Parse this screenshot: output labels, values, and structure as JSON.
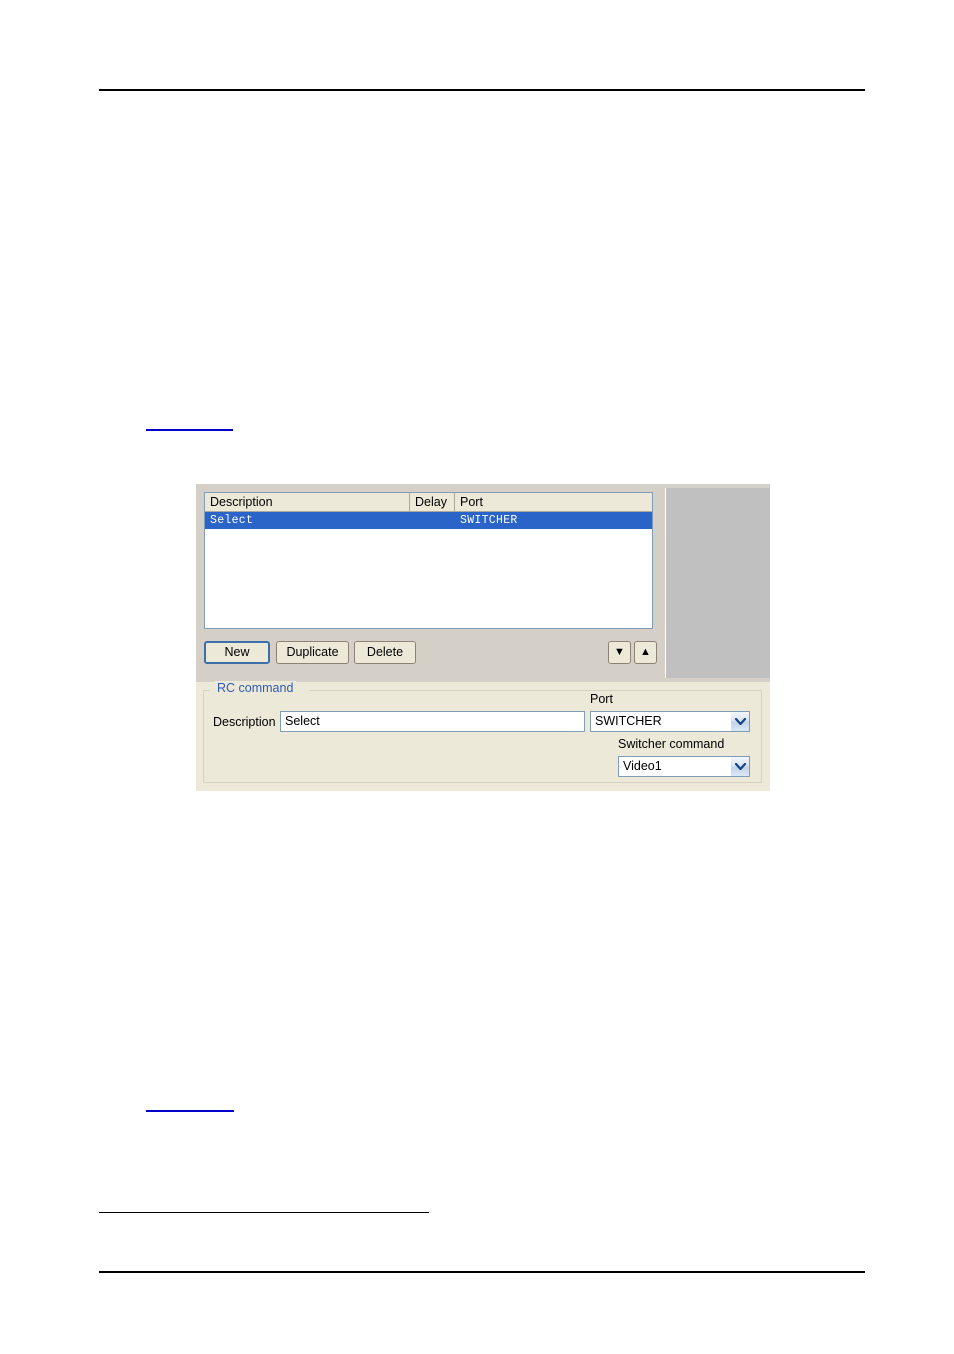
{
  "page": {
    "header_rule": true,
    "footer_rule": true,
    "footnote_rule": true,
    "links": [
      {
        "name": "cross-reference-link-top",
        "text": ""
      },
      {
        "name": "cross-reference-link-bottom",
        "text": ""
      }
    ]
  },
  "dialog": {
    "list": {
      "columns": [
        "Description",
        "Delay",
        "Port"
      ],
      "rows": [
        {
          "description": "Select",
          "delay": "",
          "port": "SWITCHER",
          "selected": true
        }
      ]
    },
    "buttons": {
      "new": "New",
      "duplicate": "Duplicate",
      "delete": "Delete",
      "move_down_icon": "triangle-down-icon",
      "move_up_icon": "triangle-up-icon"
    },
    "rc_command": {
      "legend": "RC command",
      "description_label": "Description",
      "description_value": "Select",
      "description_placeholder": "",
      "port_label": "Port",
      "port_value": "SWITCHER",
      "switcher_command_label": "Switcher command",
      "switcher_command_value": "Video1"
    }
  },
  "colors": {
    "selection_blue": "#2a64c8",
    "legend_blue": "#2f5bb7",
    "dialog_face": "#ece9d8",
    "panel_gray": "#c0c0c0",
    "field_border": "#7f9db9",
    "link_blue": "#0000cc"
  }
}
